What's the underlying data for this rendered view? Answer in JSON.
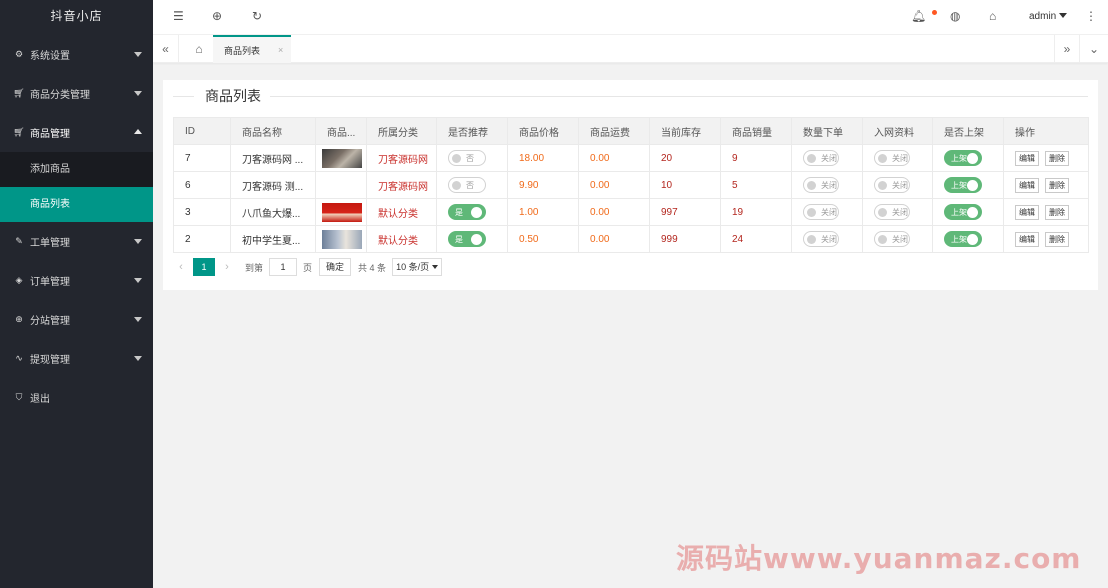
{
  "app": {
    "title": "抖音小店"
  },
  "sidebar": {
    "items": [
      {
        "label": "系统设置",
        "icon": "gear-icon"
      },
      {
        "label": "商品分类管理",
        "icon": "cart-icon"
      },
      {
        "label": "商品管理",
        "icon": "cart-icon",
        "open": true,
        "children": [
          {
            "label": "添加商品"
          },
          {
            "label": "商品列表",
            "active": true
          }
        ]
      },
      {
        "label": "工单管理",
        "icon": "edit-icon"
      },
      {
        "label": "订单管理",
        "icon": "layers-icon"
      },
      {
        "label": "分站管理",
        "icon": "globe-icon"
      },
      {
        "label": "提现管理",
        "icon": "pulse-icon"
      },
      {
        "label": "退出",
        "icon": "shield-icon"
      }
    ]
  },
  "header": {
    "user": "admin"
  },
  "tabs": {
    "active_label": "商品列表",
    "close_glyph": "×"
  },
  "page": {
    "title": "商品列表"
  },
  "table": {
    "columns": [
      "ID",
      "商品名称",
      "商品...",
      "所属分类",
      "是否推荐",
      "商品价格",
      "商品运费",
      "当前库存",
      "商品销量",
      "数量下单",
      "入网资料",
      "是否上架",
      "操作"
    ],
    "rows": [
      {
        "id": "7",
        "name": "刀客源码网 ...",
        "category": "刀客源码网",
        "recommend": "否",
        "recommend_on": false,
        "price": "18.00",
        "freight": "0.00",
        "stock": "20",
        "sales": "9",
        "qty_order": "关闭",
        "network": "关闭",
        "listed": "上架",
        "thumb": "dark"
      },
      {
        "id": "6",
        "name": "刀客源码 测...",
        "category": "刀客源码网",
        "recommend": "否",
        "recommend_on": false,
        "price": "9.90",
        "freight": "0.00",
        "stock": "10",
        "sales": "5",
        "qty_order": "关闭",
        "network": "关闭",
        "listed": "上架",
        "thumb": "none"
      },
      {
        "id": "3",
        "name": "八爪鱼大爆...",
        "category": "默认分类",
        "recommend": "是",
        "recommend_on": true,
        "price": "1.00",
        "freight": "0.00",
        "stock": "997",
        "sales": "19",
        "qty_order": "关闭",
        "network": "关闭",
        "listed": "上架",
        "thumb": "red"
      },
      {
        "id": "2",
        "name": "初中学生夏...",
        "category": "默认分类",
        "recommend": "是",
        "recommend_on": true,
        "price": "0.50",
        "freight": "0.00",
        "stock": "999",
        "sales": "24",
        "qty_order": "关闭",
        "network": "关闭",
        "listed": "上架",
        "thumb": "blue"
      }
    ],
    "actions": {
      "edit": "编辑",
      "delete": "删除"
    }
  },
  "pager": {
    "current": "1",
    "goto_label": "到第",
    "page_input": "1",
    "page_unit": "页",
    "confirm": "确定",
    "total": "共 4 条",
    "page_size": "10 条/页"
  },
  "watermark": "源码站www.yuanmaz.com",
  "colors": {
    "sidebar_bg": "#23262e",
    "accent": "#009688",
    "switch_on": "#5fb878",
    "price": "#f06a1a",
    "category": "#c9302c"
  }
}
